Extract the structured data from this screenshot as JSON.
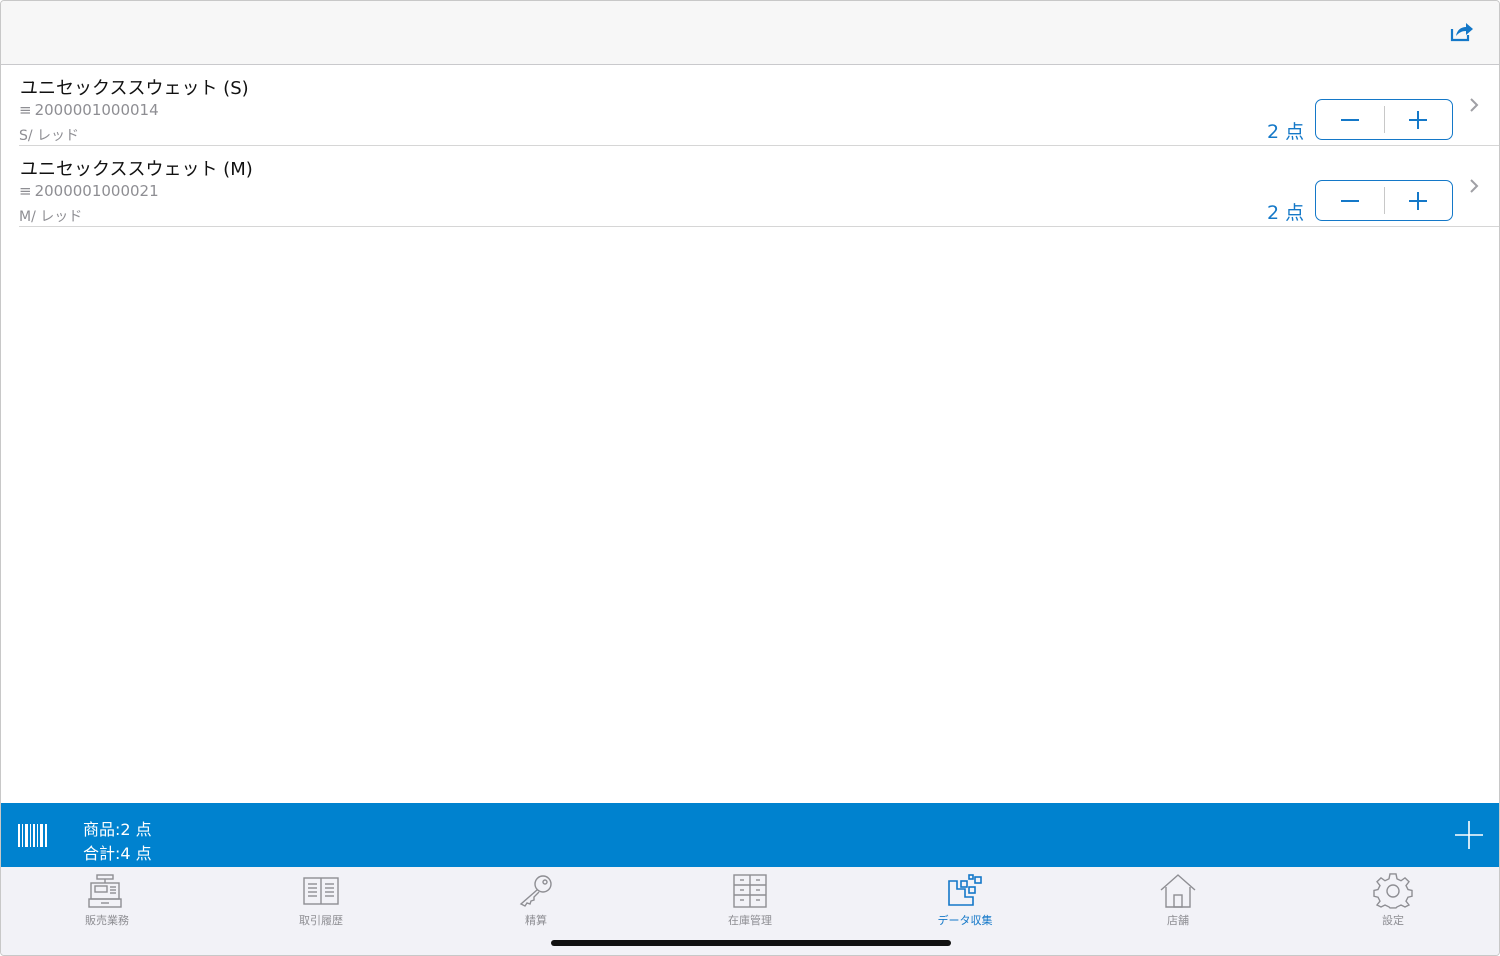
{
  "colors": {
    "accent": "#1478c8",
    "bar": "#0082cf",
    "muted": "#8e8e93"
  },
  "navbar": {
    "share_icon": "share-icon"
  },
  "items": [
    {
      "title": "ユニセックススウェット (S)",
      "code": "2000001000014",
      "variant": "S/ レッド",
      "qty": "2 点"
    },
    {
      "title": "ユニセックススウェット (M)",
      "code": "2000001000021",
      "variant": "M/ レッド",
      "qty": "2 点"
    }
  ],
  "summary": {
    "items_label": "商品:2 点",
    "total_label": "合計:4 点"
  },
  "tabs": [
    {
      "label": "販売業務",
      "icon": "register-icon"
    },
    {
      "label": "取引履歴",
      "icon": "book-icon"
    },
    {
      "label": "精算",
      "icon": "key-icon"
    },
    {
      "label": "在庫管理",
      "icon": "cabinet-icon"
    },
    {
      "label": "データ収集",
      "icon": "data-collection-icon",
      "active": true
    },
    {
      "label": "店舗",
      "icon": "store-icon"
    },
    {
      "label": "設定",
      "icon": "gear-icon"
    }
  ]
}
